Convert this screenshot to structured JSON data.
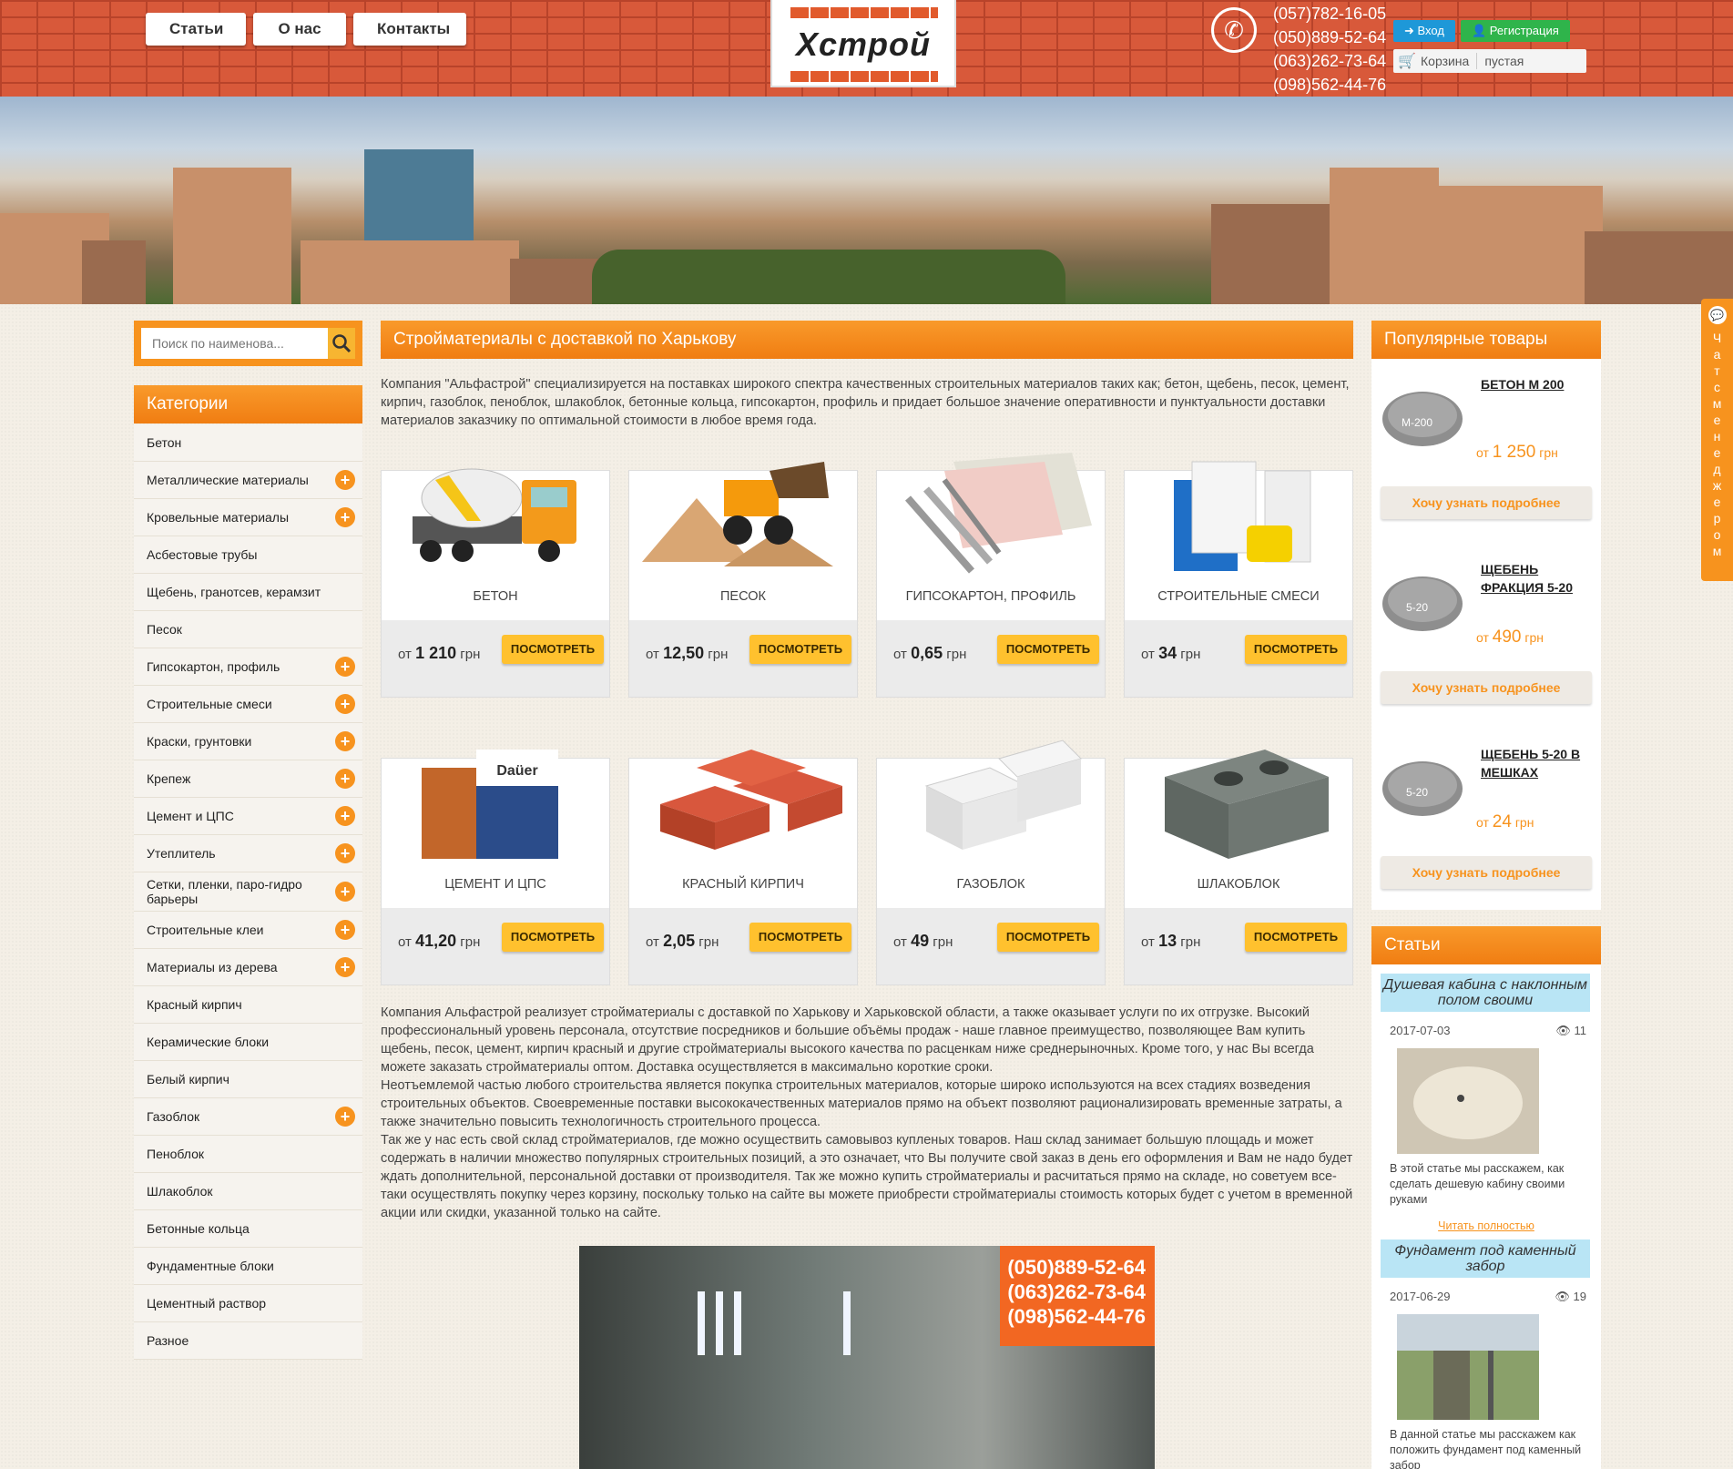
{
  "header": {
    "nav": [
      "Статьи",
      "О нас",
      "Контакты"
    ],
    "logo_text": "Хстрой",
    "phones": [
      "(057)782-16-05",
      "(050)889-52-64",
      "(063)262-73-64",
      "(098)562-44-76"
    ],
    "login_label": "Вход",
    "register_label": "Регистрация",
    "cart_label": "Корзина",
    "cart_status": "пустая"
  },
  "chat": {
    "label": "Чат с менеджером"
  },
  "search": {
    "placeholder": "Поиск по наименова..."
  },
  "categories": {
    "title": "Категории",
    "items": [
      {
        "label": "Бетон",
        "expandable": false
      },
      {
        "label": "Металлические материалы",
        "expandable": true
      },
      {
        "label": "Кровельные материалы",
        "expandable": true
      },
      {
        "label": "Асбестовые трубы",
        "expandable": false
      },
      {
        "label": "Щебень, гранотсев, керамзит",
        "expandable": false
      },
      {
        "label": "Песок",
        "expandable": false
      },
      {
        "label": "Гипсокартон, профиль",
        "expandable": true
      },
      {
        "label": "Строительные смеси",
        "expandable": true
      },
      {
        "label": "Краски, грунтовки",
        "expandable": true
      },
      {
        "label": "Крепеж",
        "expandable": true
      },
      {
        "label": "Цемент и ЦПС",
        "expandable": true
      },
      {
        "label": "Утеплитель",
        "expandable": true
      },
      {
        "label": "Сетки, пленки, паро-гидро барьеры",
        "expandable": true
      },
      {
        "label": "Строительные клеи",
        "expandable": true
      },
      {
        "label": "Материалы из дерева",
        "expandable": true
      },
      {
        "label": "Красный кирпич",
        "expandable": false
      },
      {
        "label": "Керамические блоки",
        "expandable": false
      },
      {
        "label": "Белый кирпич",
        "expandable": false
      },
      {
        "label": "Газоблок",
        "expandable": true
      },
      {
        "label": "Пеноблок",
        "expandable": false
      },
      {
        "label": "Шлакоблок",
        "expandable": false
      },
      {
        "label": "Бетонные кольца",
        "expandable": false
      },
      {
        "label": "Фундаментные блоки",
        "expandable": false
      },
      {
        "label": "Цементный раствор",
        "expandable": false
      },
      {
        "label": "Разное",
        "expandable": false
      }
    ]
  },
  "main": {
    "title": "Стройматериалы с доставкой по Харькову",
    "intro": "Компания \"Альфастрой\" специализируется на поставках широкого спектра качественных строительных материалов таких как; бетон, щебень, песок, цемент, кирпич, газоблок, пеноблок, шлакоблок, бетонные кольца, гипсокартон, профиль и придает большое значение оперативности и пунктуальности доставки материалов заказчику по оптимальной стоимости в любое время года.",
    "view_label": "ПОСМОТРЕТЬ",
    "price_prefix": "от",
    "currency": "грн",
    "products": [
      {
        "name": "БЕТОН",
        "price": "1 210",
        "icon": "concrete-mixer"
      },
      {
        "name": "ПЕСОК",
        "price": "12,50",
        "icon": "sand-loader"
      },
      {
        "name": "ГИПСОКАРТОН, ПРОФИЛЬ",
        "price": "0,65",
        "icon": "drywall-profile"
      },
      {
        "name": "СТРОИТЕЛЬНЫЕ СМЕСИ",
        "price": "34",
        "icon": "mix-bags"
      },
      {
        "name": "ЦЕМЕНТ И ЦПС",
        "price": "41,20",
        "icon": "cement-bag"
      },
      {
        "name": "КРАСНЫЙ КИРПИЧ",
        "price": "2,05",
        "icon": "red-bricks"
      },
      {
        "name": "ГАЗОБЛОК",
        "price": "49",
        "icon": "gas-blocks"
      },
      {
        "name": "ШЛАКОБЛОК",
        "price": "13",
        "icon": "cinder-block"
      }
    ],
    "paragraphs": [
      "Компания Альфастрой реализует стройматериалы с доставкой по Харькову и Харьковской области, а также оказывает услуги по их отгрузке. Высокий профессиональный уровень персонала, отсутствие посредников и большие объёмы продаж - наше главное преимущество, позволяющее Вам купить щебень, песок, цемент, кирпич красный и другие стройматериалы высокого качества по расценкам ниже среднерыночных. Кроме того, у нас Вы всегда можете заказать стройматериалы оптом. Доставка осуществляется в максимально короткие сроки.",
      "Неотъемлемой частью любого строительства является покупка строительных материалов, которые широко используются на всех стадиях возведения строительных объектов. Своевременные поставки высококачественных материалов прямо на объект позволяют рационализировать временные затраты, а также значительно повысить технологичность строительного процесса.",
      "Так же у нас есть свой склад стройматериалов, где можно осуществить самовывоз купленых товаров. Наш склад занимает большую площадь и может содержать в наличии множество популярных строительных позиций, а это означает, что Вы получите свой заказ в день его оформления и Вам не надо будет ждать дополнительной, персональной доставки от производителя. Так же можно купить стройматериалы и расчитаться прямо на складе, но советуем все-таки осуществлять покупку через корзину, поскольку только на сайте вы можете приобрести стройматериалы стоимость которых будет с учетом в временной акции или скидки, указанной только на сайте."
    ],
    "promo_phones": [
      "(050)889-52-64",
      "(063)262-73-64",
      "(098)562-44-76"
    ]
  },
  "popular": {
    "title": "Популярные товары",
    "more_label": "Хочу узнать подробнее",
    "items": [
      {
        "title": "БЕТОН М 200",
        "price": "1 250",
        "thumb_label": "М-200"
      },
      {
        "title": "ЩЕБЕНЬ ФРАКЦИЯ 5-20",
        "price": "490",
        "thumb_label": "5-20"
      },
      {
        "title": "ЩЕБЕНЬ 5-20 В МЕШКАХ",
        "price": "24",
        "thumb_label": "5-20"
      }
    ]
  },
  "articles": {
    "title": "Статьи",
    "read_more": "Читать полностью",
    "items": [
      {
        "title": "Душевая кабина с наклонным полом своими",
        "date": "2017-07-03",
        "views": "11",
        "desc": "В этой статье мы расскажем, как сделать дешевую кабину своими руками"
      },
      {
        "title": "Фундамент под каменный забор",
        "date": "2017-06-29",
        "views": "19",
        "desc": "В данной статье мы расскажем как положить фундамент под каменный забор"
      }
    ]
  },
  "colors": {
    "accent": "#f7931e",
    "brick": "#d8593a",
    "button": "#ffc12e"
  }
}
